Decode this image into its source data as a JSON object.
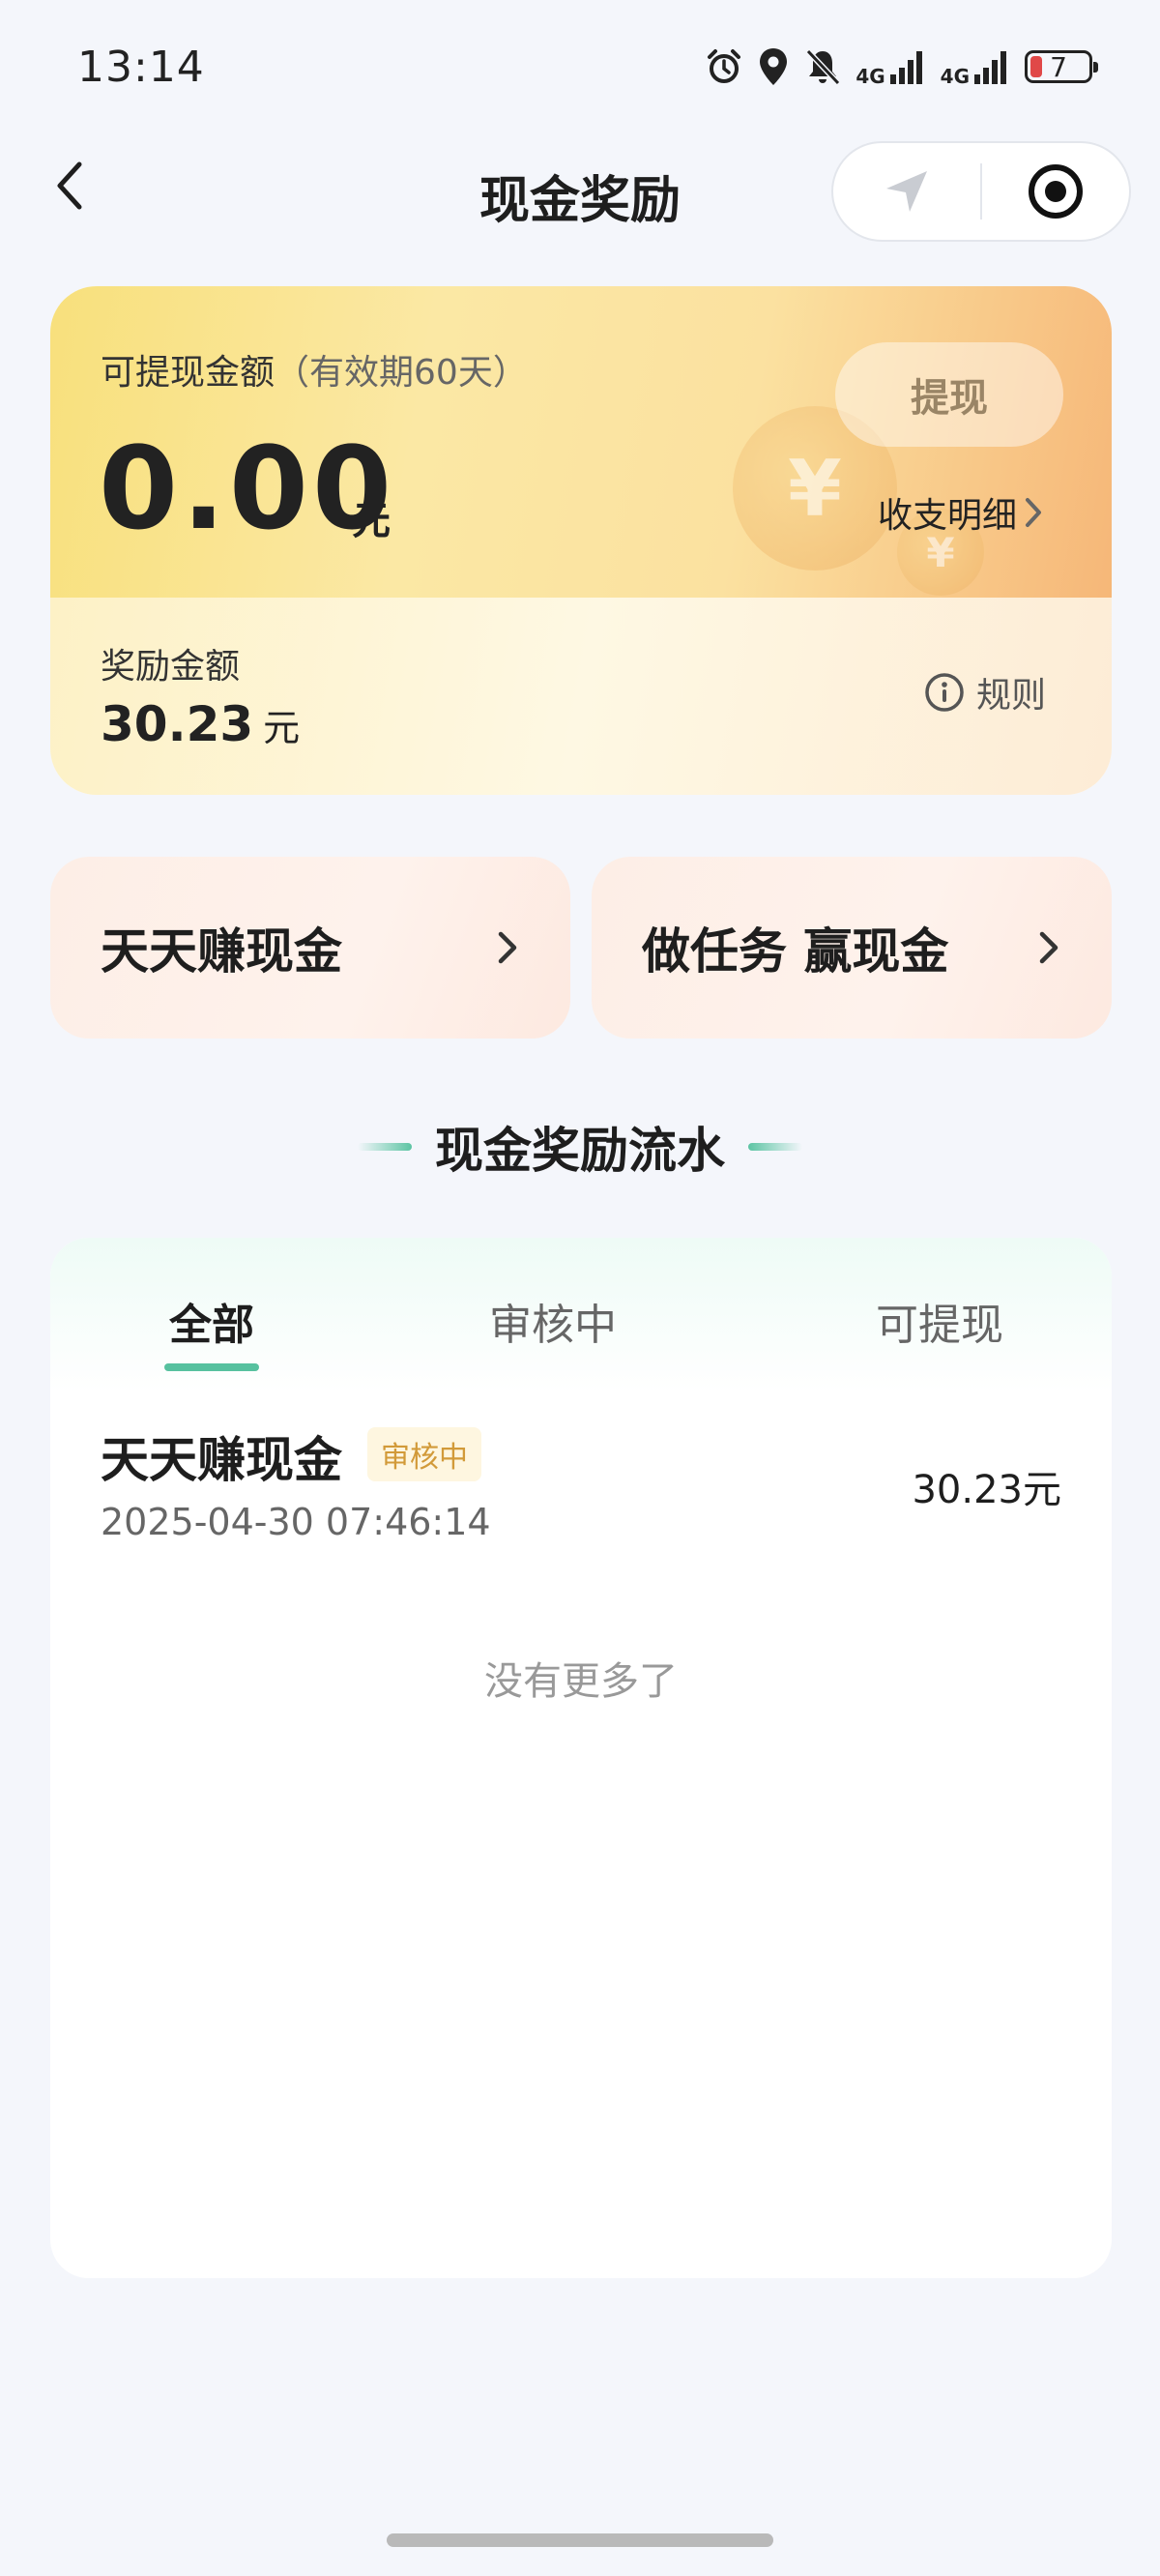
{
  "status_bar": {
    "time": "13:14",
    "network_1": "4G",
    "network_2": "4G",
    "battery_level": "7"
  },
  "nav": {
    "title": "现金奖励"
  },
  "balance_card": {
    "withdrawable_label": "可提现金额",
    "validity_note": "（有效期60天）",
    "withdrawable_amount": "0.00",
    "currency_unit": "元",
    "withdraw_button": "提现",
    "detail_link": "收支明细",
    "reward_label": "奖励金额",
    "reward_amount": "30.23",
    "reward_unit": "元",
    "rules_link": "规则"
  },
  "actions": [
    {
      "label": "天天赚现金"
    },
    {
      "label": "做任务 赢现金"
    }
  ],
  "section": {
    "title": "现金奖励流水"
  },
  "tabs": [
    {
      "label": "全部",
      "active": true
    },
    {
      "label": "审核中",
      "active": false
    },
    {
      "label": "可提现",
      "active": false
    }
  ],
  "records": [
    {
      "title": "天天赚现金",
      "badge": "审核中",
      "time": "2025-04-30 07:46:14",
      "amount": "30.23元"
    }
  ],
  "list_footer": "没有更多了",
  "colors": {
    "accent_green": "#57c19f",
    "badge_text": "#d29a39",
    "badge_bg": "#fef6e0",
    "battery_low": "#e04848"
  }
}
